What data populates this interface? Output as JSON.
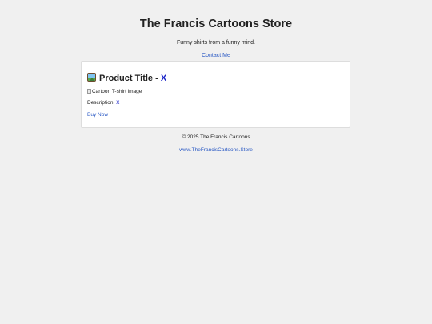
{
  "header": {
    "title": "The Francis Cartoons Store",
    "tagline": "Funny shirts from a funny mind.",
    "contact_link": "Contact Me"
  },
  "product": {
    "title_prefix": "Product Title - ",
    "title_value": "X",
    "title_icon": "framed-picture-icon",
    "image_alt": "Cartoon T-shirt image",
    "description_label": "Description: ",
    "description_value": "X",
    "buy_now": "Buy Now"
  },
  "footer": {
    "copyright": "© 2025 The Francis Cartoons",
    "store_link": "www.TheFrancisCartoons.Store"
  },
  "colors": {
    "background": "#f0f0f0",
    "card": "#ffffff",
    "link": "#2a59c4",
    "placeholder_highlight": "#1a24c8"
  }
}
